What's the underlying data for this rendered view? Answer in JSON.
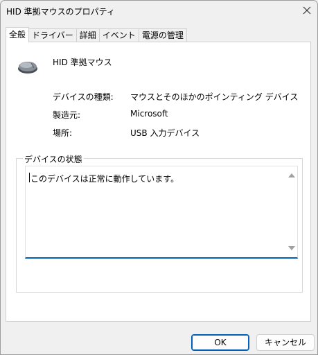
{
  "window": {
    "title": "HID 準拠マウスのプロパティ"
  },
  "tabs": [
    {
      "label": "全般"
    },
    {
      "label": "ドライバー"
    },
    {
      "label": "詳細"
    },
    {
      "label": "イベント"
    },
    {
      "label": "電源の管理"
    }
  ],
  "device": {
    "name": "HID 準拠マウス",
    "icon": "mouse-icon"
  },
  "properties": [
    {
      "label": "デバイスの種類:",
      "value": "マウスとそのほかのポインティング デバイス"
    },
    {
      "label": "製造元:",
      "value": "Microsoft"
    },
    {
      "label": "場所:",
      "value": "USB 入力デバイス"
    }
  ],
  "status_group": {
    "legend": "デバイスの状態",
    "text": "このデバイスは正常に動作しています。"
  },
  "buttons": {
    "ok": "OK",
    "cancel": "キャンセル"
  },
  "colors": {
    "accent": "#005fb8"
  }
}
